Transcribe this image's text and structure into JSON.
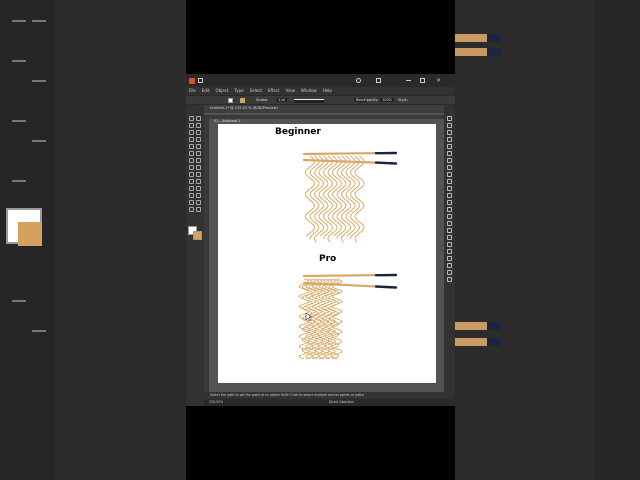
{
  "app": {
    "menu": [
      "File",
      "Edit",
      "Object",
      "Type",
      "Select",
      "Effect",
      "View",
      "Window",
      "Help"
    ],
    "control_bar": {
      "stroke_label": "Stroke:",
      "stroke_weight": "1 pt",
      "stroke_style": "Basic",
      "opacity_label": "Opacity:",
      "opacity_value": "100%",
      "style_label": "Style:"
    },
    "document_tab": "Untitled-1* @ 235.53 % (RGB/Preview)",
    "artboard_name": "01 - Artboard 1",
    "status_hint": "Select the path to set the point of an object   Shift+Click to select multiple anchor points or paths",
    "zoom_value": "235.53%",
    "bottom_tool": "Direct Selection"
  },
  "artboard": {
    "titles": {
      "beginner": "Beginner",
      "pro": "Pro"
    }
  },
  "icons": {
    "tools": [
      "selection-icon",
      "direct-selection-icon",
      "magic-wand-icon",
      "lasso-icon",
      "pen-icon",
      "curvature-icon",
      "type-icon",
      "line-icon",
      "rectangle-icon",
      "paintbrush-icon",
      "pencil-icon",
      "eraser-icon",
      "rotate-icon",
      "scale-icon",
      "width-icon",
      "warp-icon",
      "shape-builder-icon",
      "perspective-icon",
      "mesh-icon",
      "gradient-icon",
      "eyedropper-icon",
      "blend-icon",
      "symbol-sprayer-icon",
      "graph-icon",
      "artboard-icon",
      "slice-icon",
      "hand-icon",
      "zoom-icon"
    ]
  },
  "colors": {
    "noodle": "#d6a45e",
    "chopstick": "#d9a769",
    "chopstick_tip": "#1b2440",
    "app_bg": "#323232",
    "canvas_bg": "#535353"
  }
}
